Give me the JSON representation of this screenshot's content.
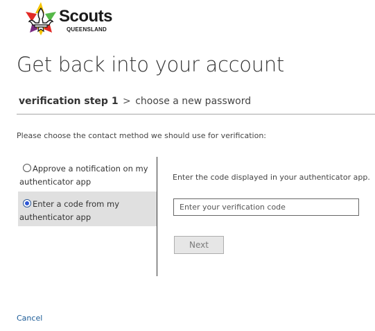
{
  "brand": {
    "name": "Scouts",
    "region": "QUEENSLAND",
    "colors": {
      "red": "#e22a26",
      "yellow": "#f5c400",
      "green": "#55b848",
      "purple": "#7b2d83"
    }
  },
  "page": {
    "title": "Get back into your account"
  },
  "breadcrumb": {
    "current": "verification step 1",
    "separator": ">",
    "next": "choose a new password"
  },
  "instruction": "Please choose the contact method we should use for verification:",
  "methods": [
    {
      "label": "Approve a notification on my authenticator app",
      "selected": false
    },
    {
      "label": "Enter a code from my authenticator app",
      "selected": true
    }
  ],
  "code_panel": {
    "instruction": "Enter the code displayed in your authenticator app.",
    "input_placeholder": "Enter your verification code",
    "input_value": "",
    "next_label": "Next",
    "next_enabled": false
  },
  "cancel_label": "Cancel",
  "colors": {
    "selected_bg": "#e0e0e0",
    "link": "#1a5a96",
    "radio_checked": "#2d56d6"
  }
}
